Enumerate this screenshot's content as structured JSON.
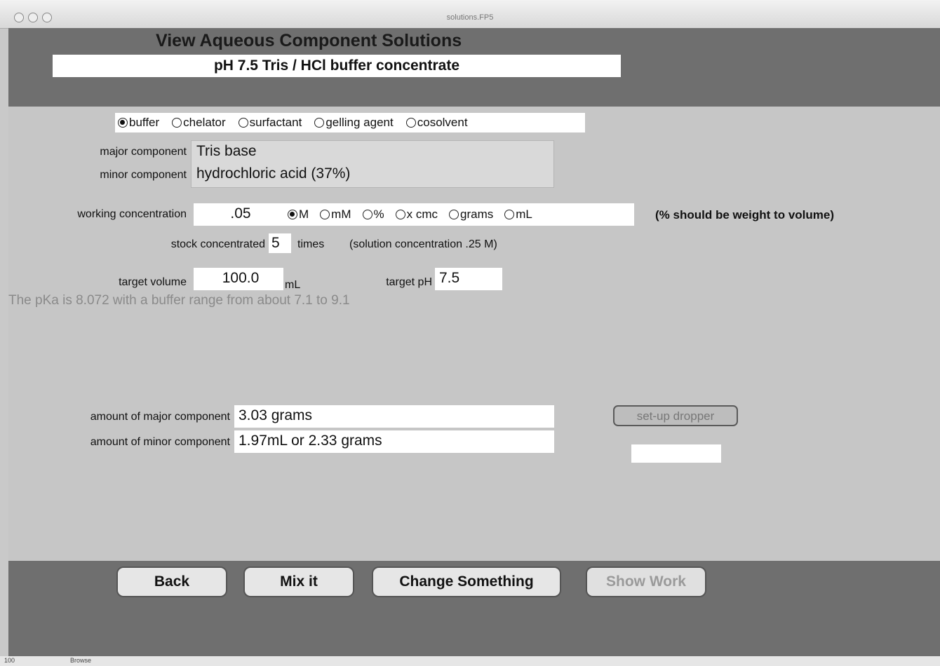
{
  "window": {
    "title": "solutions.FP5"
  },
  "header": {
    "title": "View Aqueous Component Solutions",
    "solution_name": "pH 7.5 Tris / HCl buffer concentrate"
  },
  "component_types": [
    {
      "label": "buffer",
      "selected": true
    },
    {
      "label": "chelator",
      "selected": false
    },
    {
      "label": "surfactant",
      "selected": false
    },
    {
      "label": "gelling agent",
      "selected": false
    },
    {
      "label": "cosolvent",
      "selected": false
    }
  ],
  "components": {
    "major_label": "major component",
    "major_value": "Tris base",
    "minor_label": "minor component",
    "minor_value": "hydrochloric acid (37%)"
  },
  "concentration": {
    "label": "working concentration",
    "value": ".05",
    "units": [
      {
        "label": "M",
        "selected": true
      },
      {
        "label": "mM",
        "selected": false
      },
      {
        "label": "%",
        "selected": false
      },
      {
        "label": "x cmc",
        "selected": false
      },
      {
        "label": "grams",
        "selected": false
      },
      {
        "label": "mL",
        "selected": false
      }
    ],
    "note": "(% should be weight to volume)"
  },
  "stock": {
    "label": "stock concentrated",
    "value": "5",
    "suffix": "times",
    "solution_concentration": "(solution concentration .25 M)"
  },
  "target": {
    "volume_label": "target volume",
    "volume_value": "100.0",
    "volume_unit": "mL",
    "ph_label": "target pH",
    "ph_value": "7.5"
  },
  "pka_text": "The pKa is 8.072 with a buffer range from about 7.1 to 9.1",
  "amounts": {
    "major_label": "amount of major component",
    "major_value": "3.03 grams",
    "minor_label": "amount of minor component",
    "minor_value": "1.97mL or 2.33 grams"
  },
  "dropper": {
    "button_label": "set-up dropper",
    "output": ""
  },
  "footer_buttons": {
    "back": "Back",
    "mix": "Mix it",
    "change": "Change Something",
    "show_work": "Show Work"
  },
  "statusbar": {
    "zoom": "100",
    "mode": "Browse"
  }
}
